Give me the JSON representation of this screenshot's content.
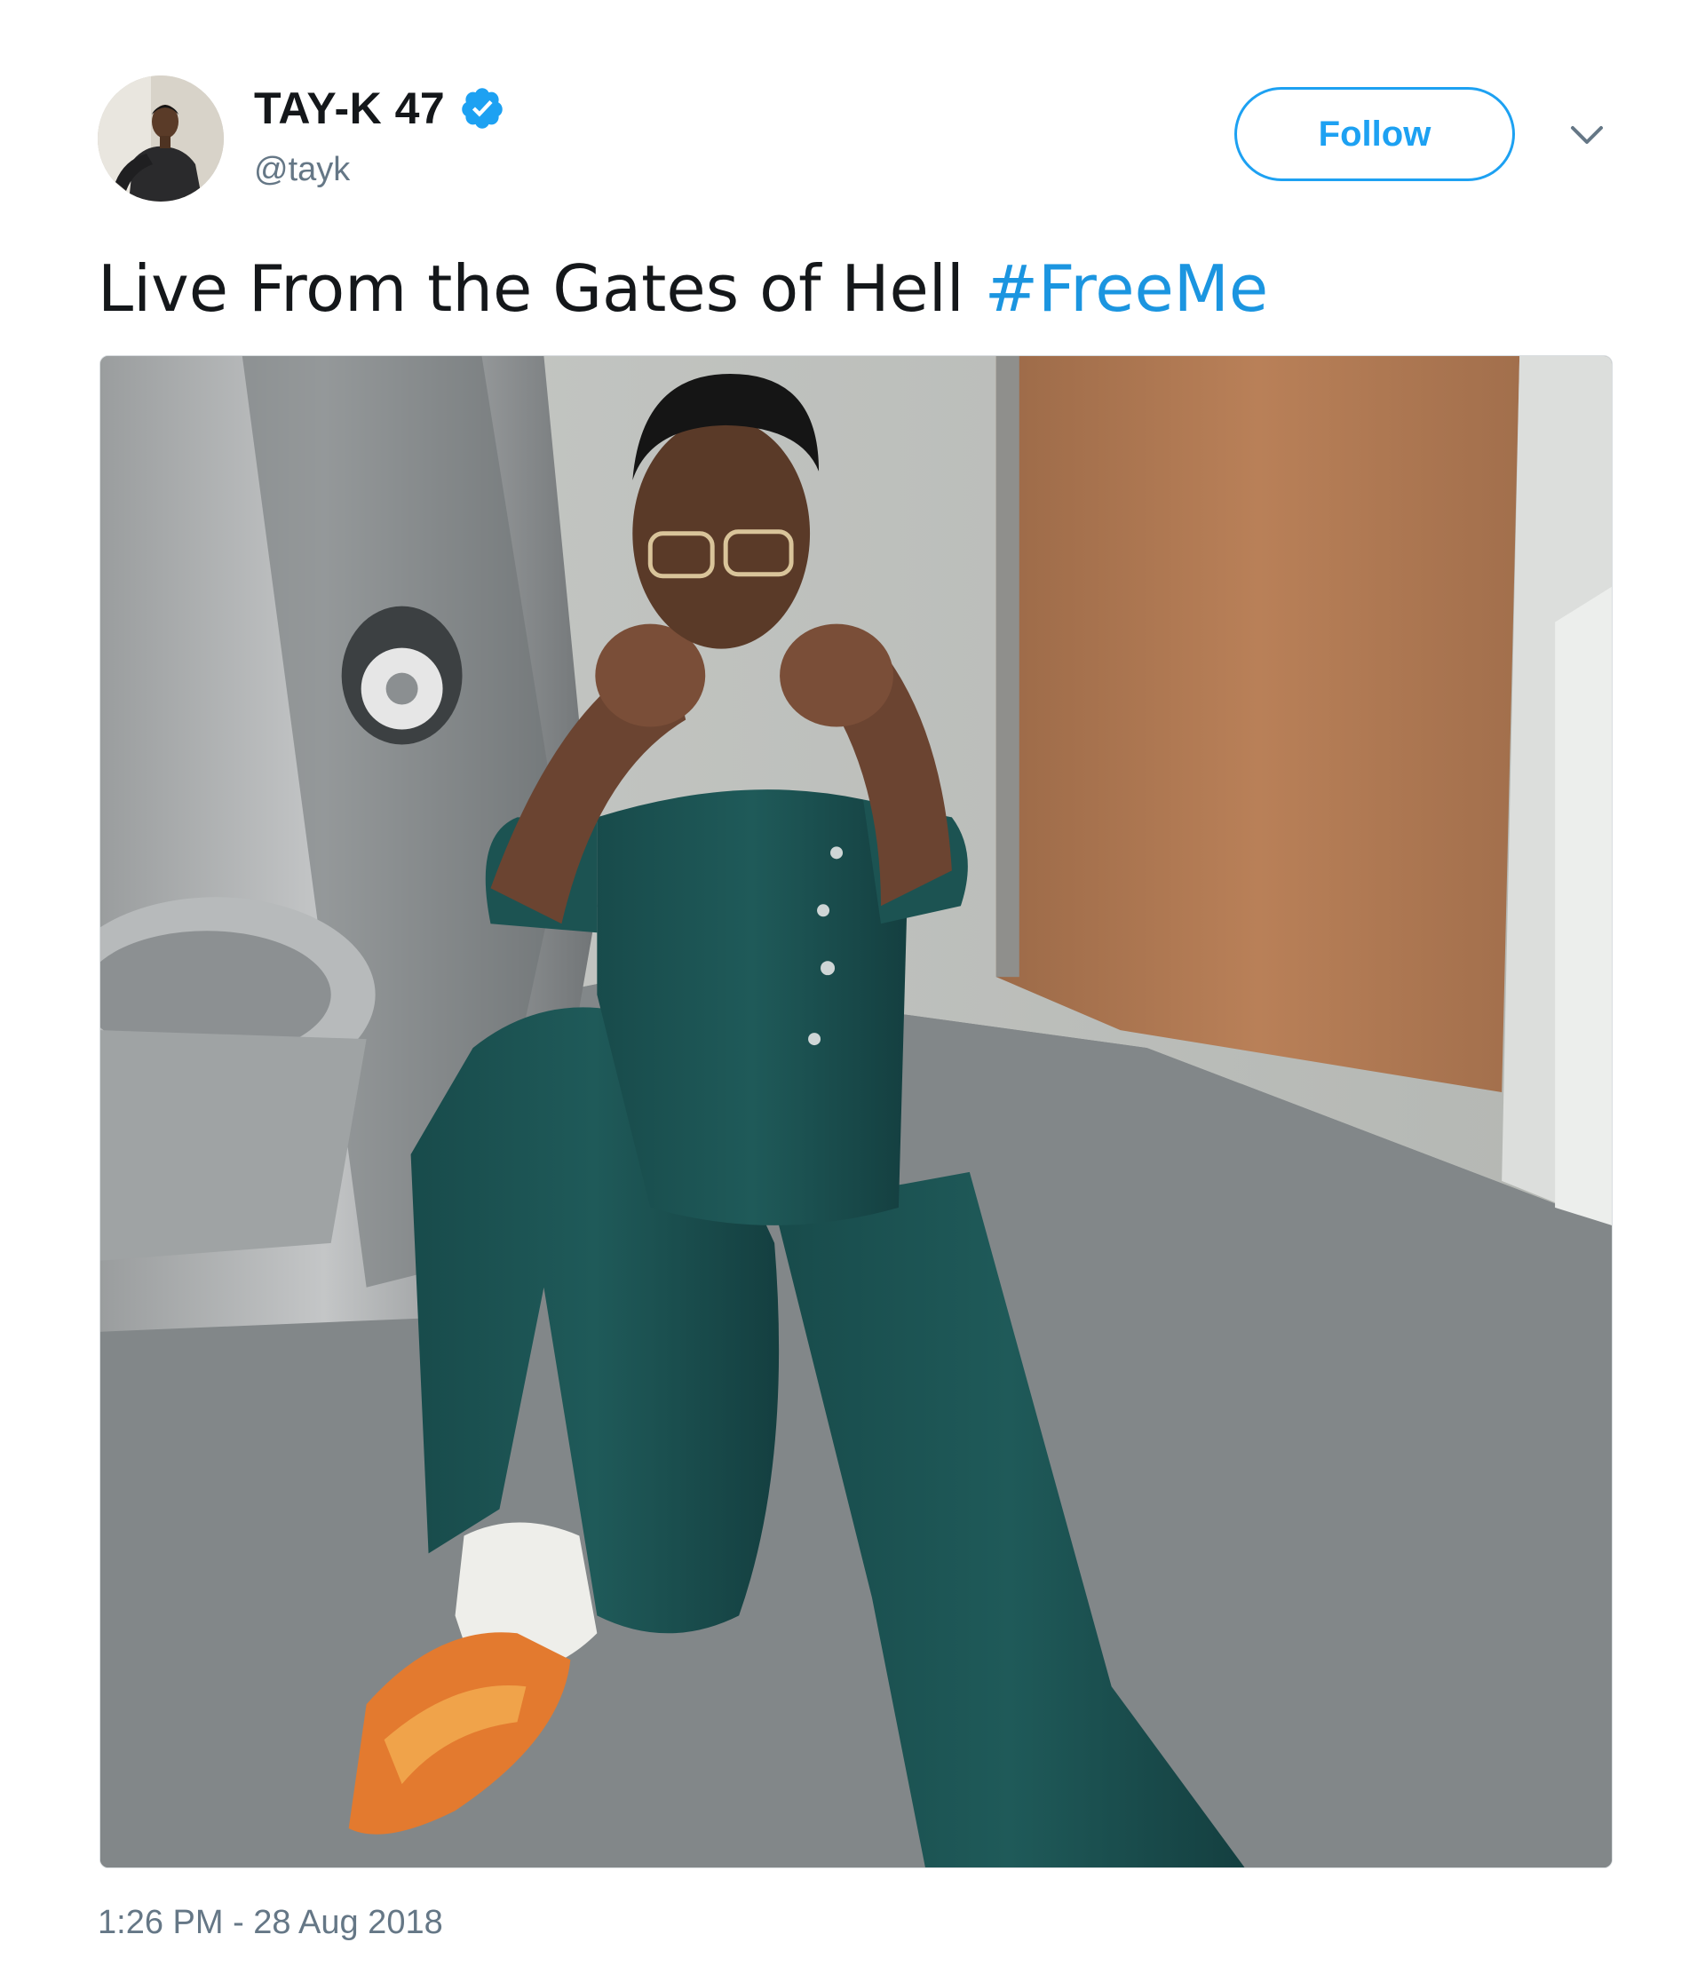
{
  "user": {
    "display_name": "TAY-K 47",
    "handle": "@tayk",
    "verified": true,
    "avatar_icon": "avatar-photo"
  },
  "actions": {
    "follow_label": "Follow",
    "menu_icon": "chevron-down-icon"
  },
  "tweet": {
    "text": "Live From the Gates of Hell ",
    "hashtag": "#FreeMe",
    "media_icon": "photo"
  },
  "meta": {
    "timestamp": "1:26 PM - 28 Aug 2018"
  },
  "colors": {
    "accent": "#1da1f2",
    "hashtag": "#1b95e0",
    "secondary_text": "#657786",
    "primary_text": "#14171a"
  }
}
